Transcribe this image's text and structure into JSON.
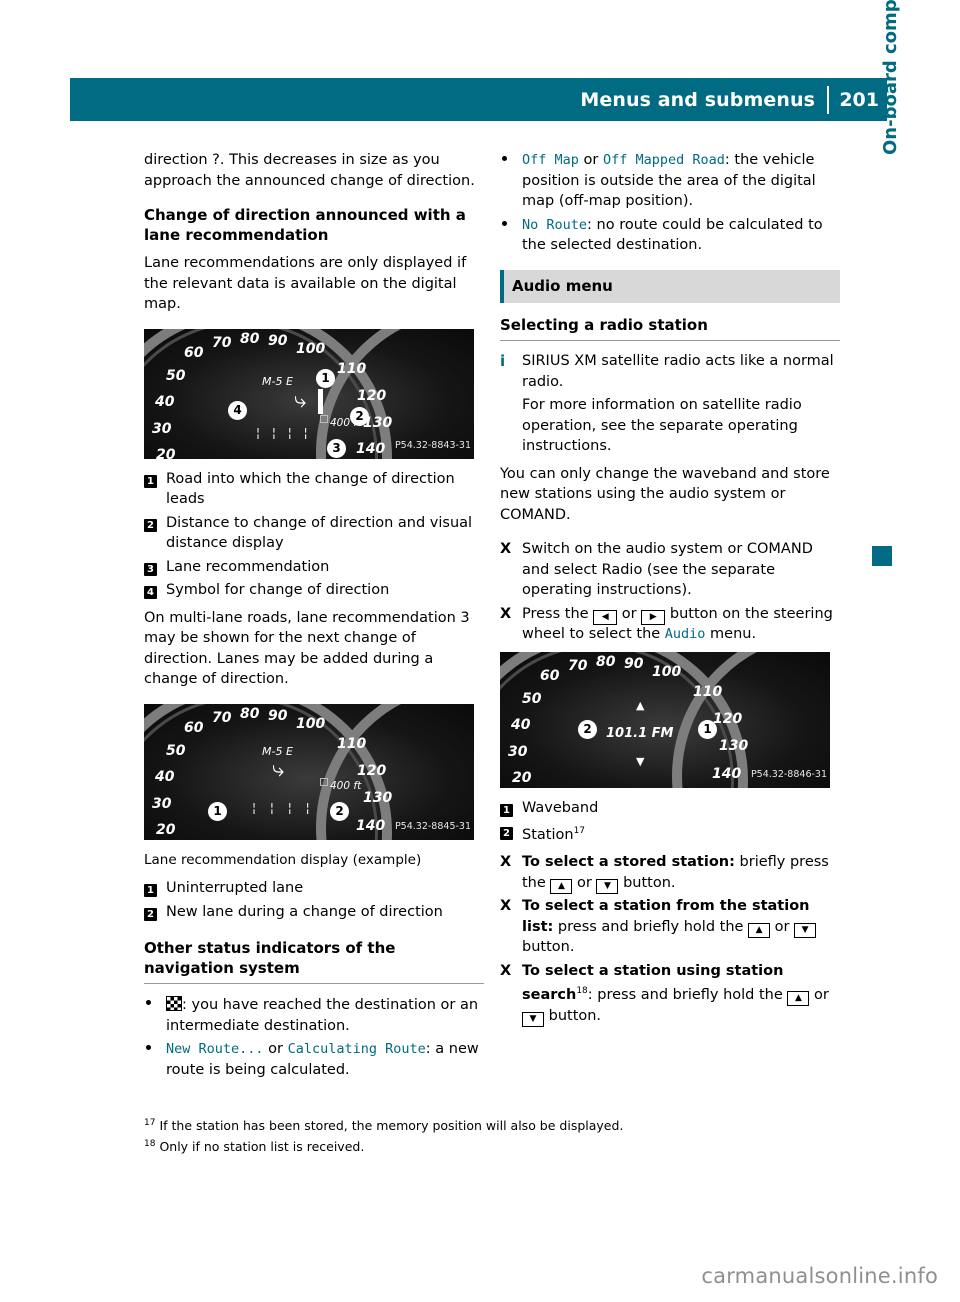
{
  "header": {
    "title": "Menus and submenus",
    "page_number": "201"
  },
  "side_title": "On-board computer and displays",
  "left_column": {
    "intro": "direction ?. This decreases in size as you approach the announced change of direction.",
    "heading_change": "Change of direction announced with a lane recommendation",
    "lane_para": "Lane recommendations are only displayed if the relevant data is available on the digital map.",
    "figure1": {
      "scale_numbers": [
        "60",
        "70",
        "80",
        "90",
        "100",
        "110",
        "120",
        "130",
        "140",
        "50",
        "40",
        "30",
        "20"
      ],
      "center_text": "M-5 E",
      "distance_text": "400 ft",
      "callouts": [
        "1",
        "2",
        "3",
        "4"
      ],
      "code": "P54.32-8843-31"
    },
    "legend1": [
      {
        "marker": "1",
        "text": "Road into which the change of direction leads"
      },
      {
        "marker": "2",
        "text": "Distance to change of direction and visual distance display"
      },
      {
        "marker": "3",
        "text": "Lane recommendation"
      },
      {
        "marker": "4",
        "text": "Symbol for change of direction"
      }
    ],
    "multilane_para": "On multi-lane roads, lane recommendation 3 may be shown for the next change of direction. Lanes may be added during a change of direction.",
    "figure2": {
      "scale_numbers": [
        "60",
        "70",
        "80",
        "90",
        "100",
        "110",
        "120",
        "130",
        "140",
        "50",
        "40",
        "30",
        "20"
      ],
      "center_text": "M-5 E",
      "distance_text": "400 ft",
      "callouts": [
        "1",
        "2"
      ],
      "code": "P54.32-8845-31"
    },
    "figure2_caption": "Lane recommendation display (example)",
    "legend2": [
      {
        "marker": "1",
        "text": "Uninterrupted lane"
      },
      {
        "marker": "2",
        "text": "New lane during a change of direction"
      }
    ],
    "heading_other": "Other status indicators of the navigation system",
    "bullets": [
      {
        "icon": "checkered-flag",
        "text": ": you have reached the destination or an intermediate destination."
      },
      {
        "mono_a": "New Route...",
        "between": " or ",
        "mono_b": "Calculating Route",
        "text": ": a new route is being calculated."
      }
    ]
  },
  "right_column": {
    "bullets": [
      {
        "mono_a": "Off Map",
        "between": " or ",
        "mono_b": "Off Mapped Road",
        "text": ": the vehicle position is outside the area of the digital map (off-map position)."
      },
      {
        "mono_a": "No Route",
        "text": ": no route could be calculated to the selected destination."
      }
    ],
    "section_band": "Audio menu",
    "heading_select": "Selecting a radio station",
    "info_note_1": "SIRIUS XM satellite radio acts like a normal radio.",
    "info_note_2": "For more information on satellite radio operation, see the separate operating instructions.",
    "waveband_para": "You can only change the waveband and store new stations using the audio system or COMAND.",
    "steps": [
      {
        "text_a": "Switch on the audio system or COMAND and select Radio (see the separate operating instructions)."
      },
      {
        "text_a": "Press the ",
        "btn_left": "◀",
        "mid": " or ",
        "btn_right": "▶",
        "text_b": " button on the steering wheel to select the ",
        "mono": "Audio",
        "text_c": " menu."
      }
    ],
    "figure3": {
      "scale_numbers": [
        "60",
        "70",
        "80",
        "90",
        "100",
        "110",
        "120",
        "130",
        "140",
        "50",
        "40",
        "30",
        "20"
      ],
      "center_text": "101.1 FM",
      "callouts": [
        "1",
        "2"
      ],
      "code": "P54.32-8846-31"
    },
    "legend3": [
      {
        "marker": "1",
        "text": "Waveband"
      },
      {
        "marker": "2",
        "text": "Station",
        "sup": "17"
      }
    ],
    "steps2": [
      {
        "bold": "To select a stored station:",
        "rest_a": " briefly press the ",
        "btn_up": "▲",
        "mid": " or ",
        "btn_dn": "▼",
        "rest_b": " button."
      },
      {
        "bold": "To select a station from the station list:",
        "rest_a": " press and briefly hold the ",
        "btn_up": "▲",
        "mid": " or ",
        "btn_dn": "▼",
        "rest_b": " button."
      },
      {
        "bold": "To select a station using station search",
        "sup": "18",
        "rest_a": ": press and briefly hold the ",
        "btn_up": "▲",
        "mid": " or ",
        "btn_dn": "▼",
        "rest_b": " button."
      }
    ]
  },
  "footnotes": [
    {
      "num": "17",
      "text": "If the station has been stored, the memory position will also be displayed."
    },
    {
      "num": "18",
      "text": "Only if no station list is received."
    }
  ],
  "watermark": "carmanualsonline.info",
  "colors": {
    "accent": "#006b82",
    "band": "#d8d8d8",
    "text": "#000000"
  }
}
